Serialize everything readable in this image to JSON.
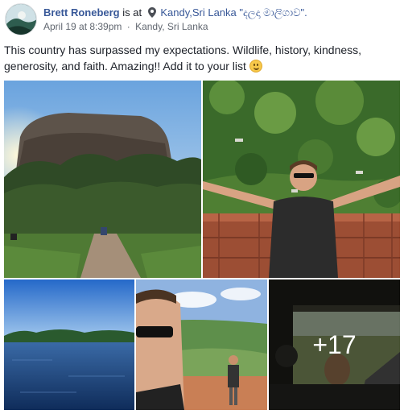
{
  "post": {
    "author_name": "Brett Roneberg",
    "is_at_text": "is at",
    "place": "Kandy,Sri Lanka \"දලදා මාලිගාව\".",
    "date": "April 19 at 8:39pm",
    "separator": "·",
    "location": "Kandy, Sri Lanka",
    "text": "This country has surpassed my expectations. Wildlife, history, kindness, generosity, and faith. Amazing!! Add it to your list"
  },
  "photos": {
    "more_count": "+17"
  },
  "icons": {
    "avatar": "profile-photo",
    "location": "map-pin-icon",
    "emoji": "smiley-emoji-icon",
    "audience": "globe-icon"
  },
  "colors": {
    "link": "#385898",
    "text": "#1d2129",
    "meta": "#616770"
  }
}
